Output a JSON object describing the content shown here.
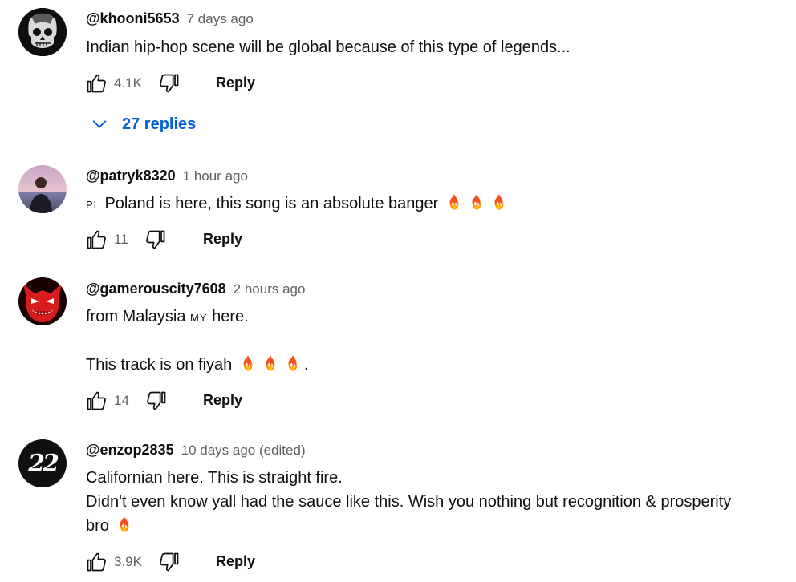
{
  "comments": [
    {
      "author": "@khooni5653",
      "time": "7 days ago",
      "lines": [
        "Indian hip-hop scene will be global because of this type of legends..."
      ],
      "likes": "4.1K",
      "reply_label": "Reply",
      "replies_label": "27 replies",
      "avatar_icon": "skull-icon"
    },
    {
      "author": "@patryk8320",
      "time": "1 hour ago",
      "flag": "PL",
      "text": "Poland is here, this song is an absolute banger",
      "likes": "11",
      "reply_label": "Reply",
      "avatar_icon": "person-photo-icon"
    },
    {
      "author": "@gamerouscity7608",
      "time": "2 hours ago",
      "line1_prefix": "from Malaysia",
      "flag": "MY",
      "line1_suffix": "here.",
      "line2": "This track is on fiyah",
      "line2_suffix": ".",
      "likes": "14",
      "reply_label": "Reply",
      "avatar_icon": "red-devil-icon"
    },
    {
      "author": "@enzop2835",
      "time": "10 days ago (edited)",
      "lines": [
        "Californian here. This is straight fire.",
        "Didn't even know yall had the sauce like this. Wish you nothing but recognition & prosperity",
        "bro"
      ],
      "likes": "3.9K",
      "reply_label": "Reply",
      "avatar_text": "22"
    }
  ],
  "colors": {
    "link": "#065fd4",
    "meta": "#606060",
    "text": "#0f0f0f"
  }
}
